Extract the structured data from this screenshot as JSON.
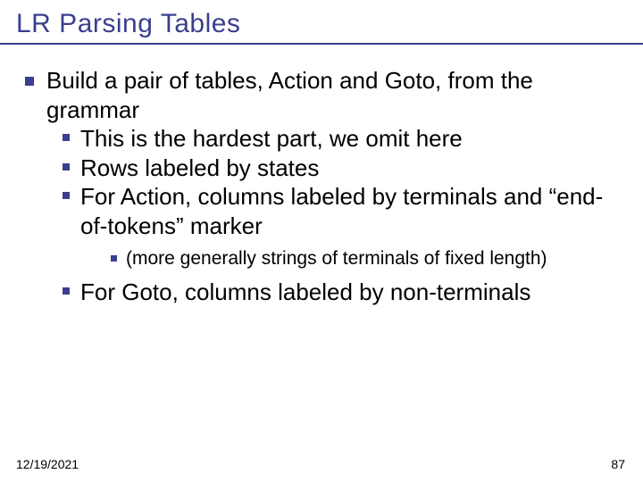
{
  "title": "LR Parsing Tables",
  "l1": "Build a pair of tables, Action and Goto, from the grammar",
  "l2a": "This is the hardest part, we omit here",
  "l2b": "Rows labeled by states",
  "l2c": "For Action, columns labeled by terminals and “end-of-tokens” marker",
  "l3a": "(more generally strings of terminals of fixed length)",
  "l2d": "For Goto, columns labeled by non-terminals",
  "footer": {
    "date": "12/19/2021",
    "page": "87"
  }
}
